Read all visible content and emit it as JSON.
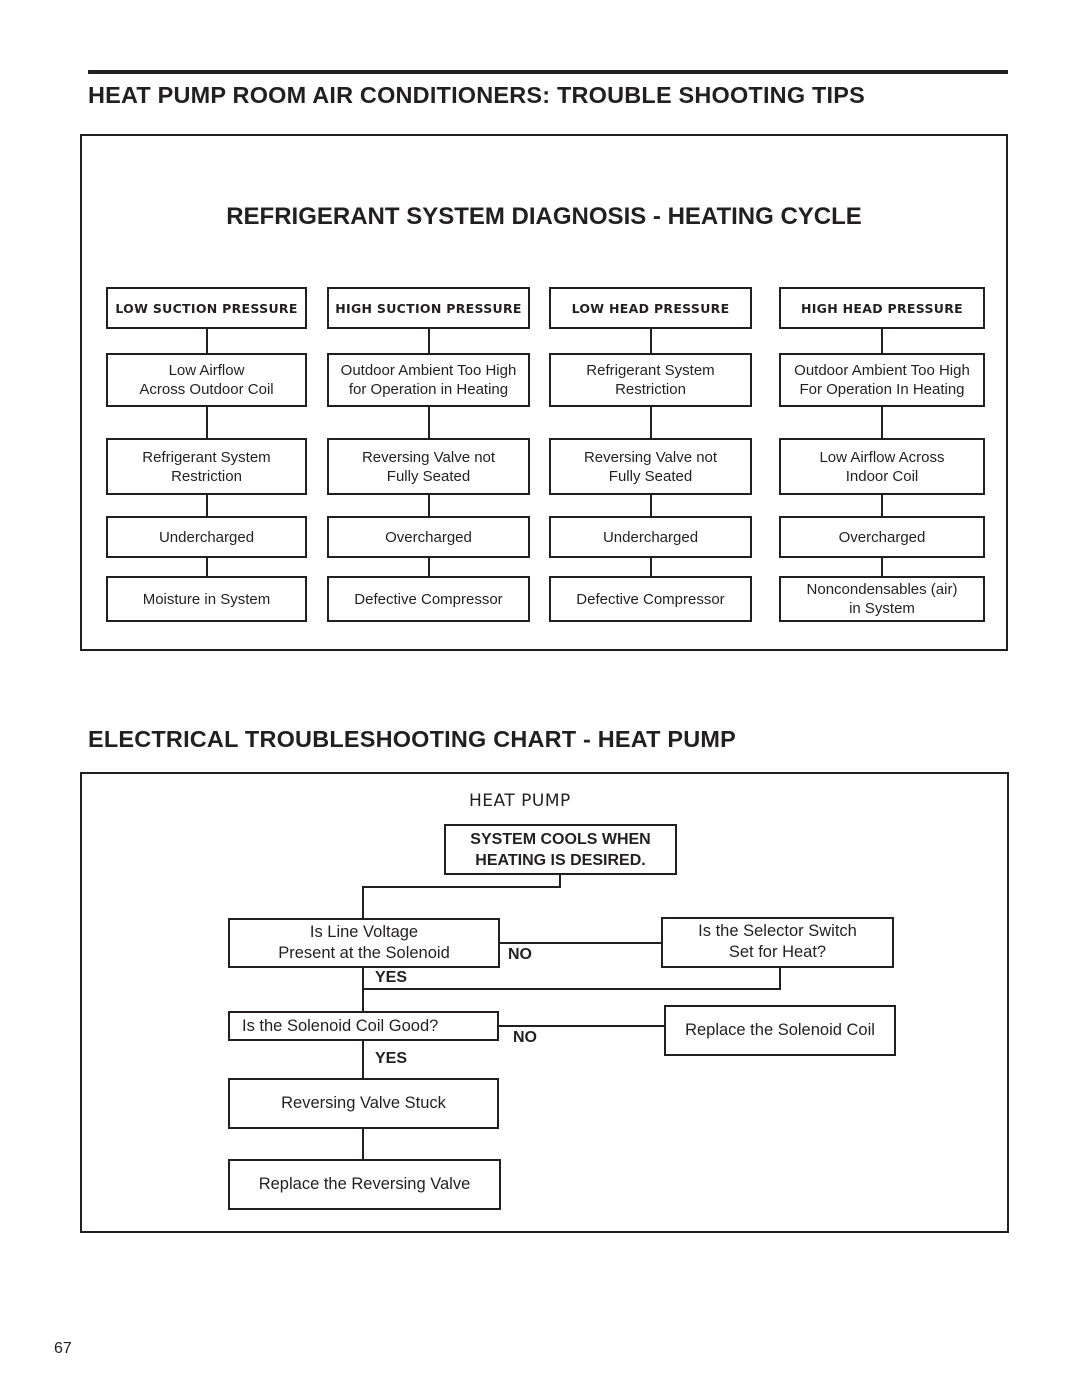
{
  "page": {
    "main_heading": "HEAT PUMP ROOM AIR CONDITIONERS: TROUBLE SHOOTING TIPS",
    "page_number": "67"
  },
  "refrigerant_diagnosis": {
    "title": "REFRIGERANT SYSTEM DIAGNOSIS - HEATING CYCLE",
    "columns": [
      {
        "header": "LOW SUCTION PRESSURE",
        "causes": [
          "Low Airflow\nAcross Outdoor Coil",
          "Refrigerant System\nRestriction",
          "Undercharged",
          "Moisture in System"
        ]
      },
      {
        "header": "HIGH SUCTION PRESSURE",
        "causes": [
          "Outdoor Ambient Too High\nfor Operation in Heating",
          "Reversing Valve not\nFully Seated",
          "Overcharged",
          "Defective Compressor"
        ]
      },
      {
        "header": "LOW HEAD PRESSURE",
        "causes": [
          "Refrigerant System\nRestriction",
          "Reversing Valve not\nFully Seated",
          "Undercharged",
          "Defective Compressor"
        ]
      },
      {
        "header": "HIGH HEAD PRESSURE",
        "causes": [
          "Outdoor Ambient Too High\nFor Operation In Heating",
          "Low Airflow Across\nIndoor Coil",
          "Overcharged",
          "Noncondensables (air)\nin System"
        ]
      }
    ]
  },
  "electrical_chart": {
    "heading": "ELECTRICAL TROUBLESHOOTING CHART - HEAT PUMP",
    "subtitle": "HEAT  PUMP",
    "start": "SYSTEM COOLS WHEN\nHEATING IS DESIRED.",
    "q_line_voltage": "Is Line Voltage\nPresent at the Solenoid",
    "q_selector_switch": "Is the Selector Switch\nSet for Heat?",
    "q_solenoid_coil": "Is the Solenoid Coil Good?",
    "a_replace_solenoid": "Replace the Solenoid Coil",
    "a_valve_stuck": "Reversing Valve Stuck",
    "a_replace_valve": "Replace the Reversing Valve",
    "label_no_1": "NO",
    "label_yes_1": "YES",
    "label_no_2": "NO",
    "label_yes_2": "YES"
  }
}
